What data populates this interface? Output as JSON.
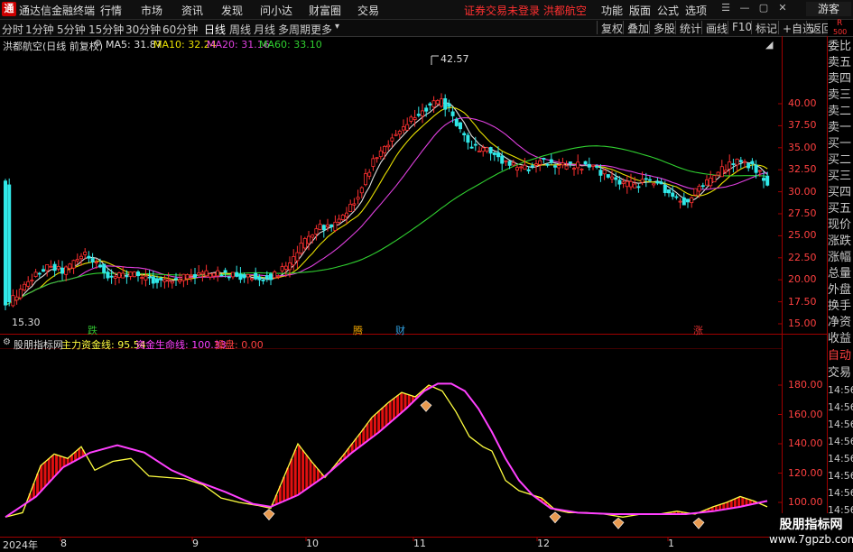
{
  "app": {
    "title": "通达信金融终端",
    "logo_char": "通"
  },
  "menu": [
    "行情",
    "市场",
    "资讯",
    "发现",
    "问小达",
    "财富圈",
    "交易"
  ],
  "notice": {
    "text": "证券交易未登录  洪都航空",
    "color": "#ff3030"
  },
  "right_menu": [
    "功能",
    "版面",
    "公式",
    "选项"
  ],
  "guest_label": "游客",
  "periods": [
    "分时",
    "1分钟",
    "5分钟",
    "15分钟",
    "30分钟",
    "60分钟",
    "日线",
    "周线",
    "月线",
    "多周期",
    "更多"
  ],
  "active_period": "日线",
  "toolbar": [
    "复权",
    "叠加",
    "多股",
    "统计",
    "画线",
    "F10",
    "标记",
    "+自选",
    "返回"
  ],
  "price_panel": {
    "title": "洪都航空(日线 前复权)",
    "ma": [
      {
        "label": "MA5: 31.87",
        "color": "#e0e0e0"
      },
      {
        "label": "MA10: 32.24",
        "color": "#e8e000"
      },
      {
        "label": "MA20: 31.16",
        "color": "#e040e0"
      },
      {
        "label": "MA60: 33.10",
        "color": "#30d030"
      }
    ],
    "high_label": "42.57",
    "low_label": "15.30",
    "axis": [
      "40.00",
      "37.50",
      "35.00",
      "32.50",
      "30.00",
      "27.50",
      "25.00",
      "22.50",
      "20.00",
      "17.50",
      "15.00"
    ],
    "markers": [
      {
        "text": "跌",
        "color": "#30c030"
      },
      {
        "text": "腾",
        "color": "#e8a000"
      },
      {
        "text": "财",
        "color": "#30a0e0"
      },
      {
        "text": "涨",
        "color": "#e03030"
      }
    ]
  },
  "indicator_panel": {
    "name": "股朋指标网",
    "line1": {
      "label": "主力资金线: 95.54",
      "color": "#ffff40"
    },
    "line2": {
      "label": "资金生命线: 100.33",
      "color": "#ff40ff"
    },
    "line3": {
      "label": "操盘: 0.00",
      "color": "#ff4040"
    },
    "axis": [
      "180.00",
      "160.00",
      "140.00",
      "120.00",
      "100.00"
    ]
  },
  "date_axis": [
    "2024年",
    "8",
    "9",
    "10",
    "11",
    "12",
    "1"
  ],
  "sidebar_top": {
    "r_label": "R",
    "r_value": "500"
  },
  "sidebar_items": [
    "委比",
    "卖五",
    "卖四",
    "卖三",
    "卖二",
    "卖一",
    "买一",
    "买二",
    "买三",
    "买四",
    "买五",
    "现价",
    "涨跌",
    "涨幅",
    "总量",
    "外盘",
    "换手",
    "净资",
    "收益"
  ],
  "sidebar_bottom": [
    "自动",
    "交易",
    "14:56",
    "14:56",
    "14:56",
    "14:56",
    "14:56",
    "14:56",
    "14:56",
    "14:56",
    "14:56"
  ],
  "watermark": {
    "title": "股朋指标网",
    "url": "www.7gpzb.com"
  },
  "colors": {
    "up": "#ff3030",
    "down": "#30e8e8",
    "ma5": "#e0e0e0",
    "ma10": "#e8e000",
    "ma20": "#e040e0",
    "ma60": "#30d030",
    "axis_red": "#c00000"
  }
}
